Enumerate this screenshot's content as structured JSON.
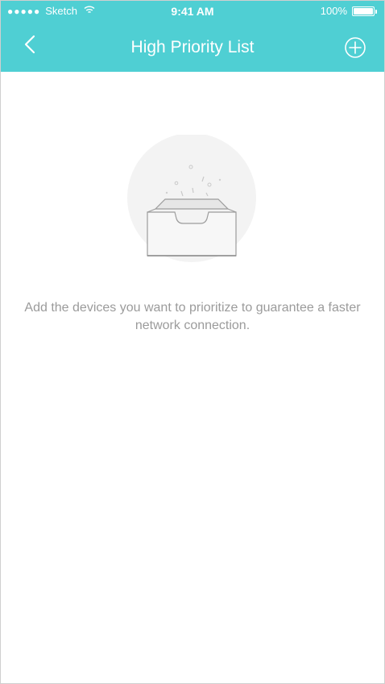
{
  "status_bar": {
    "carrier": "Sketch",
    "signal_icon": "signal-dots-icon",
    "wifi_icon": "wifi-icon",
    "time": "9:41 AM",
    "battery": "100%",
    "battery_icon": "battery-icon"
  },
  "nav": {
    "title": "High Priority List",
    "back_icon": "chevron-left-icon",
    "add_icon": "plus-circle-icon"
  },
  "empty_state": {
    "illustration": "empty-tray-icon",
    "message": "Add the devices you want to prioritize to guarantee a faster network connection."
  },
  "colors": {
    "header": "#4fcfd3",
    "text_muted": "#9b9b9b",
    "illustration_bg": "#f2f2f2"
  }
}
